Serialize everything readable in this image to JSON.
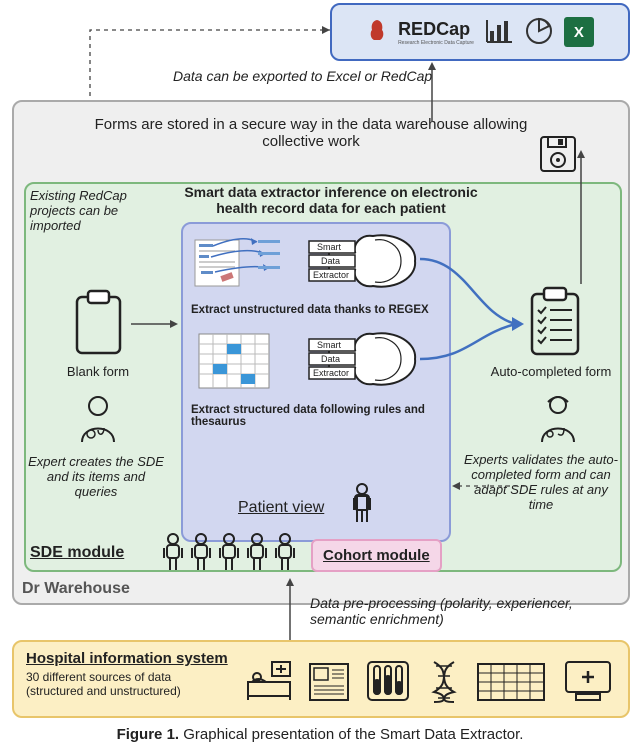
{
  "export": {
    "redcap_label": "REDCap",
    "redcap_sub": "Research Electronic Data Capture",
    "excel_glyph": "X"
  },
  "captions": {
    "export_caption": "Data can be exported to Excel or RedCap",
    "forms_stored": "Forms are stored in a secure way in the data warehouse allowing collective work",
    "preprocessing": "Data pre-processing (polarity, experiencer, semantic enrichment)"
  },
  "left": {
    "import_note": "Existing RedCap projects can be imported",
    "blank_form": "Blank form",
    "expert_note": "Expert creates the SDE and its items and queries"
  },
  "center": {
    "inference_title": "Smart data extractor inference on electronic health record data for each patient",
    "regex_line": "Extract unstructured data thanks to REGEX",
    "rules_line": "Extract structured data following rules and thesaurus",
    "patient_view": "Patient view",
    "brain_labels": {
      "a": "Smart",
      "b": "Data",
      "c": "Extractor"
    }
  },
  "right": {
    "autocompleted": "Auto-completed form",
    "validate_note": "Experts validates the auto-completed form and can adapt SDE rules at any time"
  },
  "modules": {
    "sde": "SDE module",
    "cohort": "Cohort module",
    "drw": "Dr Warehouse"
  },
  "his": {
    "title": "Hospital information system",
    "subtitle": "30 different sources of data (structured and unstructured)"
  },
  "figure": {
    "num": "Figure 1.",
    "caption": " Graphical presentation of the Smart Data Extractor."
  }
}
